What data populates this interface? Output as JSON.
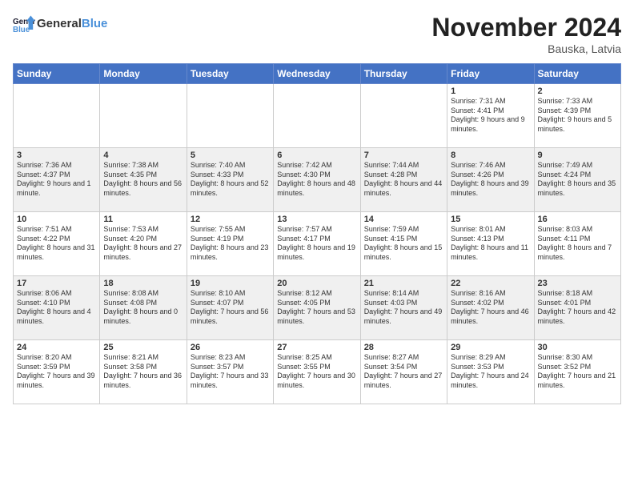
{
  "header": {
    "logo_line1": "General",
    "logo_line2": "Blue",
    "month": "November 2024",
    "location": "Bauska, Latvia"
  },
  "days_of_week": [
    "Sunday",
    "Monday",
    "Tuesday",
    "Wednesday",
    "Thursday",
    "Friday",
    "Saturday"
  ],
  "weeks": [
    [
      {
        "day": "",
        "info": ""
      },
      {
        "day": "",
        "info": ""
      },
      {
        "day": "",
        "info": ""
      },
      {
        "day": "",
        "info": ""
      },
      {
        "day": "",
        "info": ""
      },
      {
        "day": "1",
        "info": "Sunrise: 7:31 AM\nSunset: 4:41 PM\nDaylight: 9 hours and 9 minutes."
      },
      {
        "day": "2",
        "info": "Sunrise: 7:33 AM\nSunset: 4:39 PM\nDaylight: 9 hours and 5 minutes."
      }
    ],
    [
      {
        "day": "3",
        "info": "Sunrise: 7:36 AM\nSunset: 4:37 PM\nDaylight: 9 hours and 1 minute."
      },
      {
        "day": "4",
        "info": "Sunrise: 7:38 AM\nSunset: 4:35 PM\nDaylight: 8 hours and 56 minutes."
      },
      {
        "day": "5",
        "info": "Sunrise: 7:40 AM\nSunset: 4:33 PM\nDaylight: 8 hours and 52 minutes."
      },
      {
        "day": "6",
        "info": "Sunrise: 7:42 AM\nSunset: 4:30 PM\nDaylight: 8 hours and 48 minutes."
      },
      {
        "day": "7",
        "info": "Sunrise: 7:44 AM\nSunset: 4:28 PM\nDaylight: 8 hours and 44 minutes."
      },
      {
        "day": "8",
        "info": "Sunrise: 7:46 AM\nSunset: 4:26 PM\nDaylight: 8 hours and 39 minutes."
      },
      {
        "day": "9",
        "info": "Sunrise: 7:49 AM\nSunset: 4:24 PM\nDaylight: 8 hours and 35 minutes."
      }
    ],
    [
      {
        "day": "10",
        "info": "Sunrise: 7:51 AM\nSunset: 4:22 PM\nDaylight: 8 hours and 31 minutes."
      },
      {
        "day": "11",
        "info": "Sunrise: 7:53 AM\nSunset: 4:20 PM\nDaylight: 8 hours and 27 minutes."
      },
      {
        "day": "12",
        "info": "Sunrise: 7:55 AM\nSunset: 4:19 PM\nDaylight: 8 hours and 23 minutes."
      },
      {
        "day": "13",
        "info": "Sunrise: 7:57 AM\nSunset: 4:17 PM\nDaylight: 8 hours and 19 minutes."
      },
      {
        "day": "14",
        "info": "Sunrise: 7:59 AM\nSunset: 4:15 PM\nDaylight: 8 hours and 15 minutes."
      },
      {
        "day": "15",
        "info": "Sunrise: 8:01 AM\nSunset: 4:13 PM\nDaylight: 8 hours and 11 minutes."
      },
      {
        "day": "16",
        "info": "Sunrise: 8:03 AM\nSunset: 4:11 PM\nDaylight: 8 hours and 7 minutes."
      }
    ],
    [
      {
        "day": "17",
        "info": "Sunrise: 8:06 AM\nSunset: 4:10 PM\nDaylight: 8 hours and 4 minutes."
      },
      {
        "day": "18",
        "info": "Sunrise: 8:08 AM\nSunset: 4:08 PM\nDaylight: 8 hours and 0 minutes."
      },
      {
        "day": "19",
        "info": "Sunrise: 8:10 AM\nSunset: 4:07 PM\nDaylight: 7 hours and 56 minutes."
      },
      {
        "day": "20",
        "info": "Sunrise: 8:12 AM\nSunset: 4:05 PM\nDaylight: 7 hours and 53 minutes."
      },
      {
        "day": "21",
        "info": "Sunrise: 8:14 AM\nSunset: 4:03 PM\nDaylight: 7 hours and 49 minutes."
      },
      {
        "day": "22",
        "info": "Sunrise: 8:16 AM\nSunset: 4:02 PM\nDaylight: 7 hours and 46 minutes."
      },
      {
        "day": "23",
        "info": "Sunrise: 8:18 AM\nSunset: 4:01 PM\nDaylight: 7 hours and 42 minutes."
      }
    ],
    [
      {
        "day": "24",
        "info": "Sunrise: 8:20 AM\nSunset: 3:59 PM\nDaylight: 7 hours and 39 minutes."
      },
      {
        "day": "25",
        "info": "Sunrise: 8:21 AM\nSunset: 3:58 PM\nDaylight: 7 hours and 36 minutes."
      },
      {
        "day": "26",
        "info": "Sunrise: 8:23 AM\nSunset: 3:57 PM\nDaylight: 7 hours and 33 minutes."
      },
      {
        "day": "27",
        "info": "Sunrise: 8:25 AM\nSunset: 3:55 PM\nDaylight: 7 hours and 30 minutes."
      },
      {
        "day": "28",
        "info": "Sunrise: 8:27 AM\nSunset: 3:54 PM\nDaylight: 7 hours and 27 minutes."
      },
      {
        "day": "29",
        "info": "Sunrise: 8:29 AM\nSunset: 3:53 PM\nDaylight: 7 hours and 24 minutes."
      },
      {
        "day": "30",
        "info": "Sunrise: 8:30 AM\nSunset: 3:52 PM\nDaylight: 7 hours and 21 minutes."
      }
    ]
  ]
}
